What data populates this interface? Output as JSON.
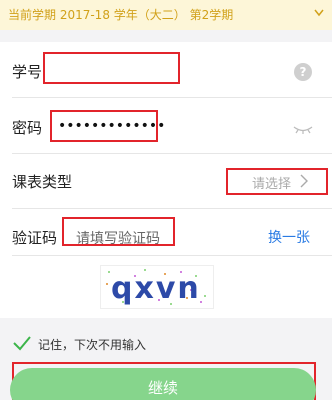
{
  "banner": {
    "text": "当前学期 2017-18 学年（大二） 第2学期",
    "chevron_icon": "chevron-down-icon"
  },
  "form": {
    "student_id": {
      "label": "学号",
      "value": "",
      "help_icon": "question-icon"
    },
    "password": {
      "label": "密码",
      "value": "•••••••••••••",
      "eye_icon": "eye-closed-icon"
    },
    "schedule_type": {
      "label": "课表类型",
      "placeholder": "请选择",
      "chevron_icon": "chevron-right-icon"
    },
    "captcha": {
      "label": "验证码",
      "placeholder": "请填写验证码",
      "refresh_label": "换一张",
      "image_text": "qxvn"
    }
  },
  "remember": {
    "checked": true,
    "label": "记住，下次不用输入"
  },
  "continue_label": "继续",
  "colors": {
    "banner_bg": "#fdf6d8",
    "banner_text": "#d1a11a",
    "link": "#2a7be4",
    "button": "#86d58c",
    "highlight_box": "#e2242b",
    "check": "#3cb54a"
  }
}
